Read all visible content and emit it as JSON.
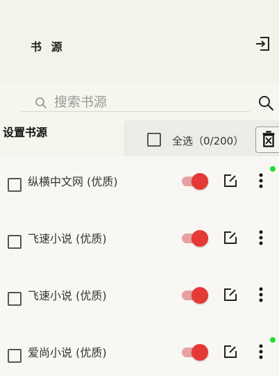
{
  "header": {
    "title": "书 源"
  },
  "search": {
    "placeholder": "搜索书源"
  },
  "section": {
    "title": "设置书源"
  },
  "selection": {
    "label": "全选（0/200）"
  },
  "colors": {
    "accent": "#e53935",
    "toggle_track": "#e8a0a0",
    "indicator": "#22dd33"
  },
  "sources": [
    {
      "name": "纵横中文网 (优质)",
      "enabled": true,
      "updated": true
    },
    {
      "name": " 飞速小说 (优质)",
      "enabled": true,
      "updated": false
    },
    {
      "name": "飞速小说  (优质)",
      "enabled": true,
      "updated": false
    },
    {
      "name": "爱尚小说 (优质)",
      "enabled": true,
      "updated": true
    }
  ]
}
